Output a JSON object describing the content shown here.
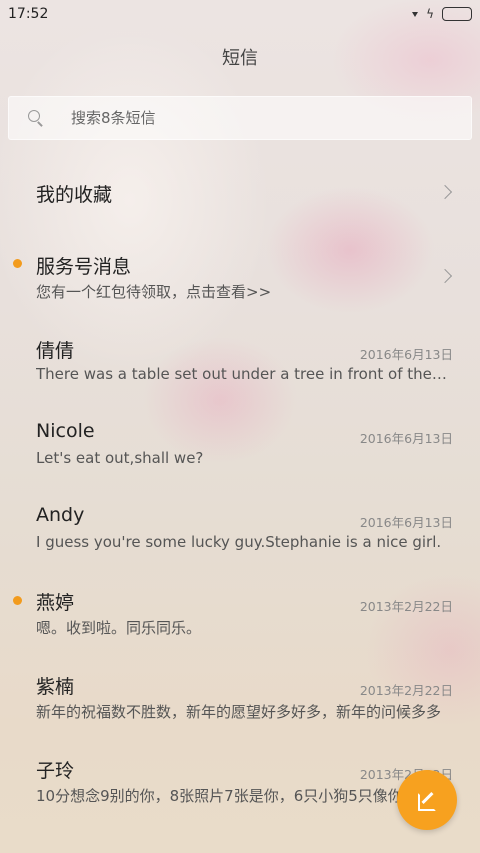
{
  "status_bar": {
    "time": "17:52"
  },
  "header": {
    "title": "短信"
  },
  "search": {
    "placeholder": "搜索8条短信"
  },
  "conversations": [
    {
      "name": "我的收藏",
      "preview": "",
      "date": "",
      "unread": false,
      "chevron": true
    },
    {
      "name": "服务号消息",
      "preview": "您有一个红包待领取，点击查看>>",
      "date": "",
      "unread": true,
      "chevron": true
    },
    {
      "name": "倩倩",
      "preview": "There was a table set out under a tree in front of the house",
      "date": "2016年6月13日",
      "unread": false,
      "chevron": false
    },
    {
      "name": "Nicole",
      "preview": "Let's eat out,shall we?",
      "date": "2016年6月13日",
      "unread": false,
      "chevron": false
    },
    {
      "name": "Andy",
      "preview": "I guess you're some lucky guy.Stephanie is a nice girl.",
      "date": "2016年6月13日",
      "unread": false,
      "chevron": false
    },
    {
      "name": "燕婷",
      "preview": "嗯。收到啦。同乐同乐。",
      "date": "2013年2月22日",
      "unread": true,
      "chevron": false
    },
    {
      "name": "紫楠",
      "preview": "新年的祝福数不胜数，新年的愿望好多好多，新年的问候多多",
      "date": "2013年2月22日",
      "unread": false,
      "chevron": false
    },
    {
      "name": "子玲",
      "preview": "10分想念9别的你，8张照片7张是你，6只小狗5只像你",
      "date": "2013年2月22日",
      "unread": false,
      "chevron": false
    }
  ],
  "colors": {
    "accent": "#f29b1d"
  }
}
